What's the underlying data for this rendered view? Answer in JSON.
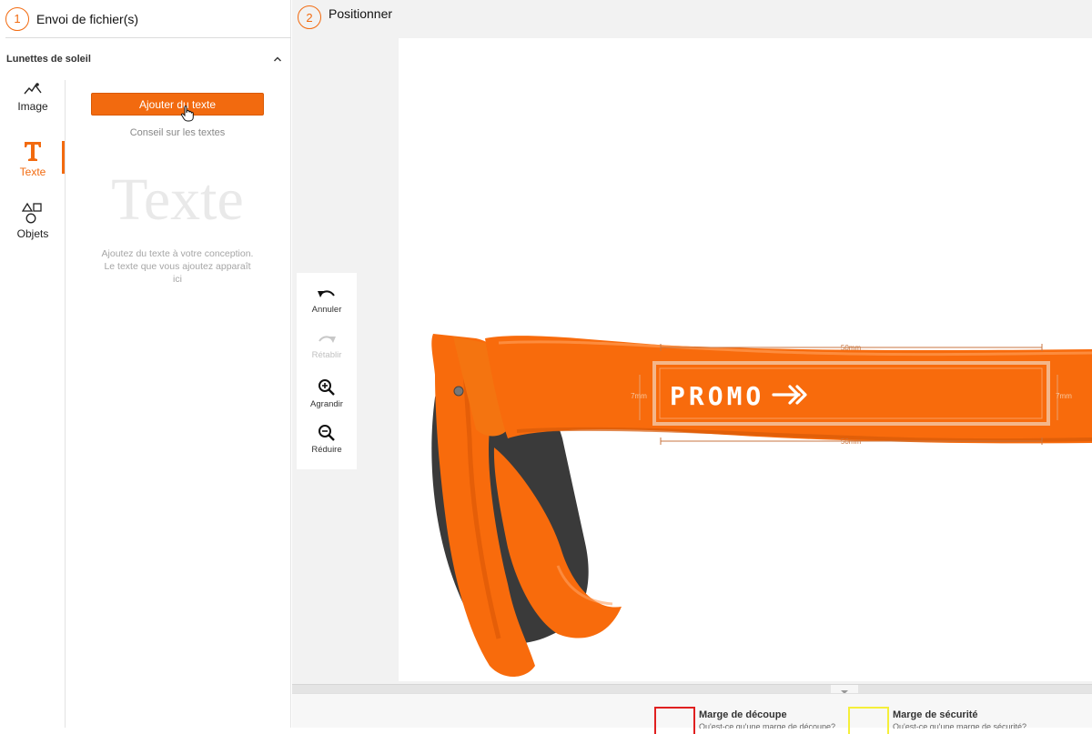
{
  "steps": {
    "step1": {
      "number": "1",
      "label": "Envoi de fichier(s)"
    },
    "step2": {
      "number": "2",
      "label": "Positionner"
    }
  },
  "section": {
    "title": "Lunettes de soleil",
    "icon": "chevron-up-icon"
  },
  "tools": [
    {
      "label": "Image",
      "icon": "image-icon"
    },
    {
      "label": "Texte",
      "icon": "text-t-icon",
      "active": true
    },
    {
      "label": "Objets",
      "icon": "shapes-icon"
    }
  ],
  "text_panel": {
    "add_button_label": "Ajouter du texte",
    "tips_link": "Conseil sur les textes",
    "placeholder_word": "Texte",
    "help_line1": "Ajoutez du texte à votre conception.",
    "help_line2": "Le texte que vous ajoutez apparaît",
    "help_line3": "ici"
  },
  "history_toolbar": {
    "undo": "Annuler",
    "redo": "Rétablir",
    "zoom_in": "Agrandir",
    "zoom_out": "Réduire"
  },
  "product": {
    "print_text": "PROMO",
    "width_top": "50mm",
    "width_bottom": "50mm",
    "height_left": "7mm",
    "height_right": "7mm"
  },
  "legend": {
    "cut_title": "Marge de découpe",
    "cut_sub": "Qu'est-ce qu'une marge de découpe?",
    "safe_title": "Marge de sécurité",
    "safe_sub": "Qu'est-ce qu'une marge de sécurité?"
  },
  "colors": {
    "accent": "#f26a0f",
    "cut_margin": "#e02020",
    "safe_margin": "#f5ef3a",
    "frame_orange": "#f86b0c"
  }
}
